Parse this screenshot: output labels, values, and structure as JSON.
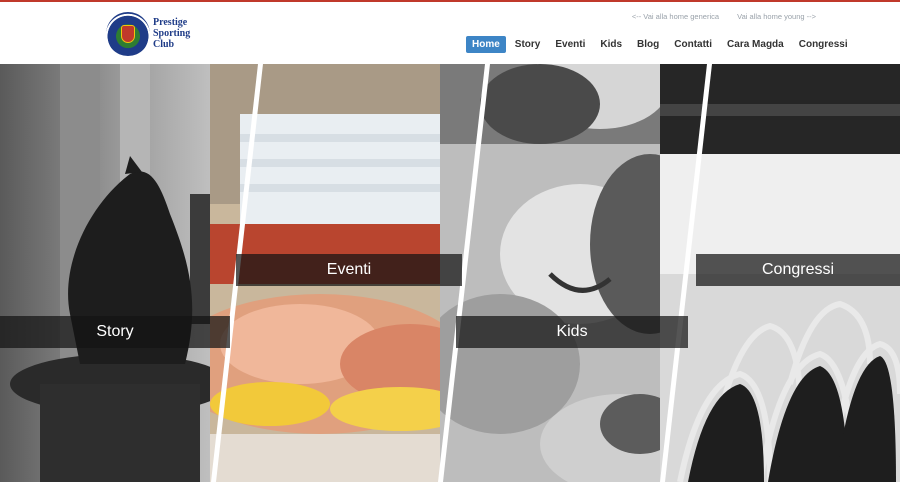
{
  "brand": {
    "line1": "Prestige",
    "line2": "Sporting",
    "line3": "Club"
  },
  "toplinks": {
    "generic": "<-- Vai alla home generica",
    "young": "Vai alla home young -->"
  },
  "nav": {
    "home": "Home",
    "story": "Story",
    "eventi": "Eventi",
    "kids": "Kids",
    "blog": "Blog",
    "contatti": "Contatti",
    "cara_magda": "Cara Magda",
    "congressi": "Congressi"
  },
  "panels": {
    "story": "Story",
    "eventi": "Eventi",
    "kids": "Kids",
    "congressi": "Congressi"
  },
  "colors": {
    "accent": "#3d85c6",
    "topline": "#c0392b"
  }
}
